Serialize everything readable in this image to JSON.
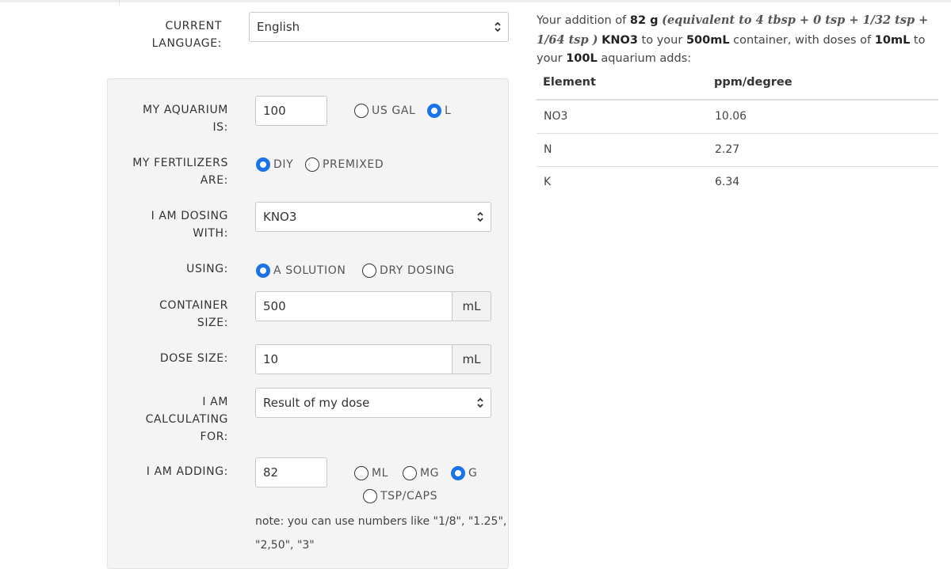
{
  "language": {
    "label_line1": "CURRENT",
    "label_line2": "LANGUAGE:",
    "selected": "English"
  },
  "form": {
    "aquarium": {
      "label_line1": "MY AQUARIUM",
      "label_line2": "IS:",
      "value": "100",
      "unit_options": [
        {
          "label": "US GAL",
          "checked": false
        },
        {
          "label": "L",
          "checked": true
        }
      ]
    },
    "fertilizers": {
      "label_line1": "MY FERTILIZERS",
      "label_line2": "ARE:",
      "options": [
        {
          "label": "DIY",
          "checked": true
        },
        {
          "label": "PREMIXED",
          "checked": false
        }
      ]
    },
    "dosing_with": {
      "label_line1": "I AM DOSING",
      "label_line2": "WITH:",
      "selected": "KNO3"
    },
    "using": {
      "label": "USING:",
      "options": [
        {
          "label": "A SOLUTION",
          "checked": true
        },
        {
          "label": "DRY DOSING",
          "checked": false
        }
      ]
    },
    "container": {
      "label_line1": "CONTAINER",
      "label_line2": "SIZE:",
      "value": "500",
      "unit": "mL"
    },
    "dose": {
      "label": "DOSE SIZE:",
      "value": "10",
      "unit": "mL"
    },
    "calculating_for": {
      "label_line1": "I AM",
      "label_line2": "CALCULATING",
      "label_line3": "FOR:",
      "selected": "Result of my dose"
    },
    "adding": {
      "label": "I AM ADDING:",
      "value": "82",
      "unit_options": [
        {
          "label": "ML",
          "checked": false
        },
        {
          "label": "MG",
          "checked": false
        },
        {
          "label": "G",
          "checked": true
        },
        {
          "label": "TSP/CAPS",
          "checked": false
        }
      ],
      "note_line1": "note: you can use numbers like \"1/8\", \"1.25\",",
      "note_line2": "\"2,50\", \"3\""
    }
  },
  "result": {
    "t1": "Your addition of ",
    "amount": "82 g",
    "t2": " ",
    "equivalent": "(equivalent to 4 tbsp + 0 tsp + 1/32 tsp + 1/64 tsp )",
    "t3": " ",
    "compound": "KNO3",
    "t4": " to your ",
    "container": "500mL",
    "t5": " container, with doses of ",
    "dose": "10mL",
    "t6": " to your ",
    "tank": "100L",
    "t7": " aquarium adds:",
    "table": {
      "headers": [
        "Element",
        "ppm/degree"
      ],
      "rows": [
        {
          "element": "NO3",
          "value": "10.06"
        },
        {
          "element": "N",
          "value": "2.27"
        },
        {
          "element": "K",
          "value": "6.34"
        }
      ]
    }
  },
  "icons": {
    "select_arrow": "up-down-chevron-icon"
  }
}
